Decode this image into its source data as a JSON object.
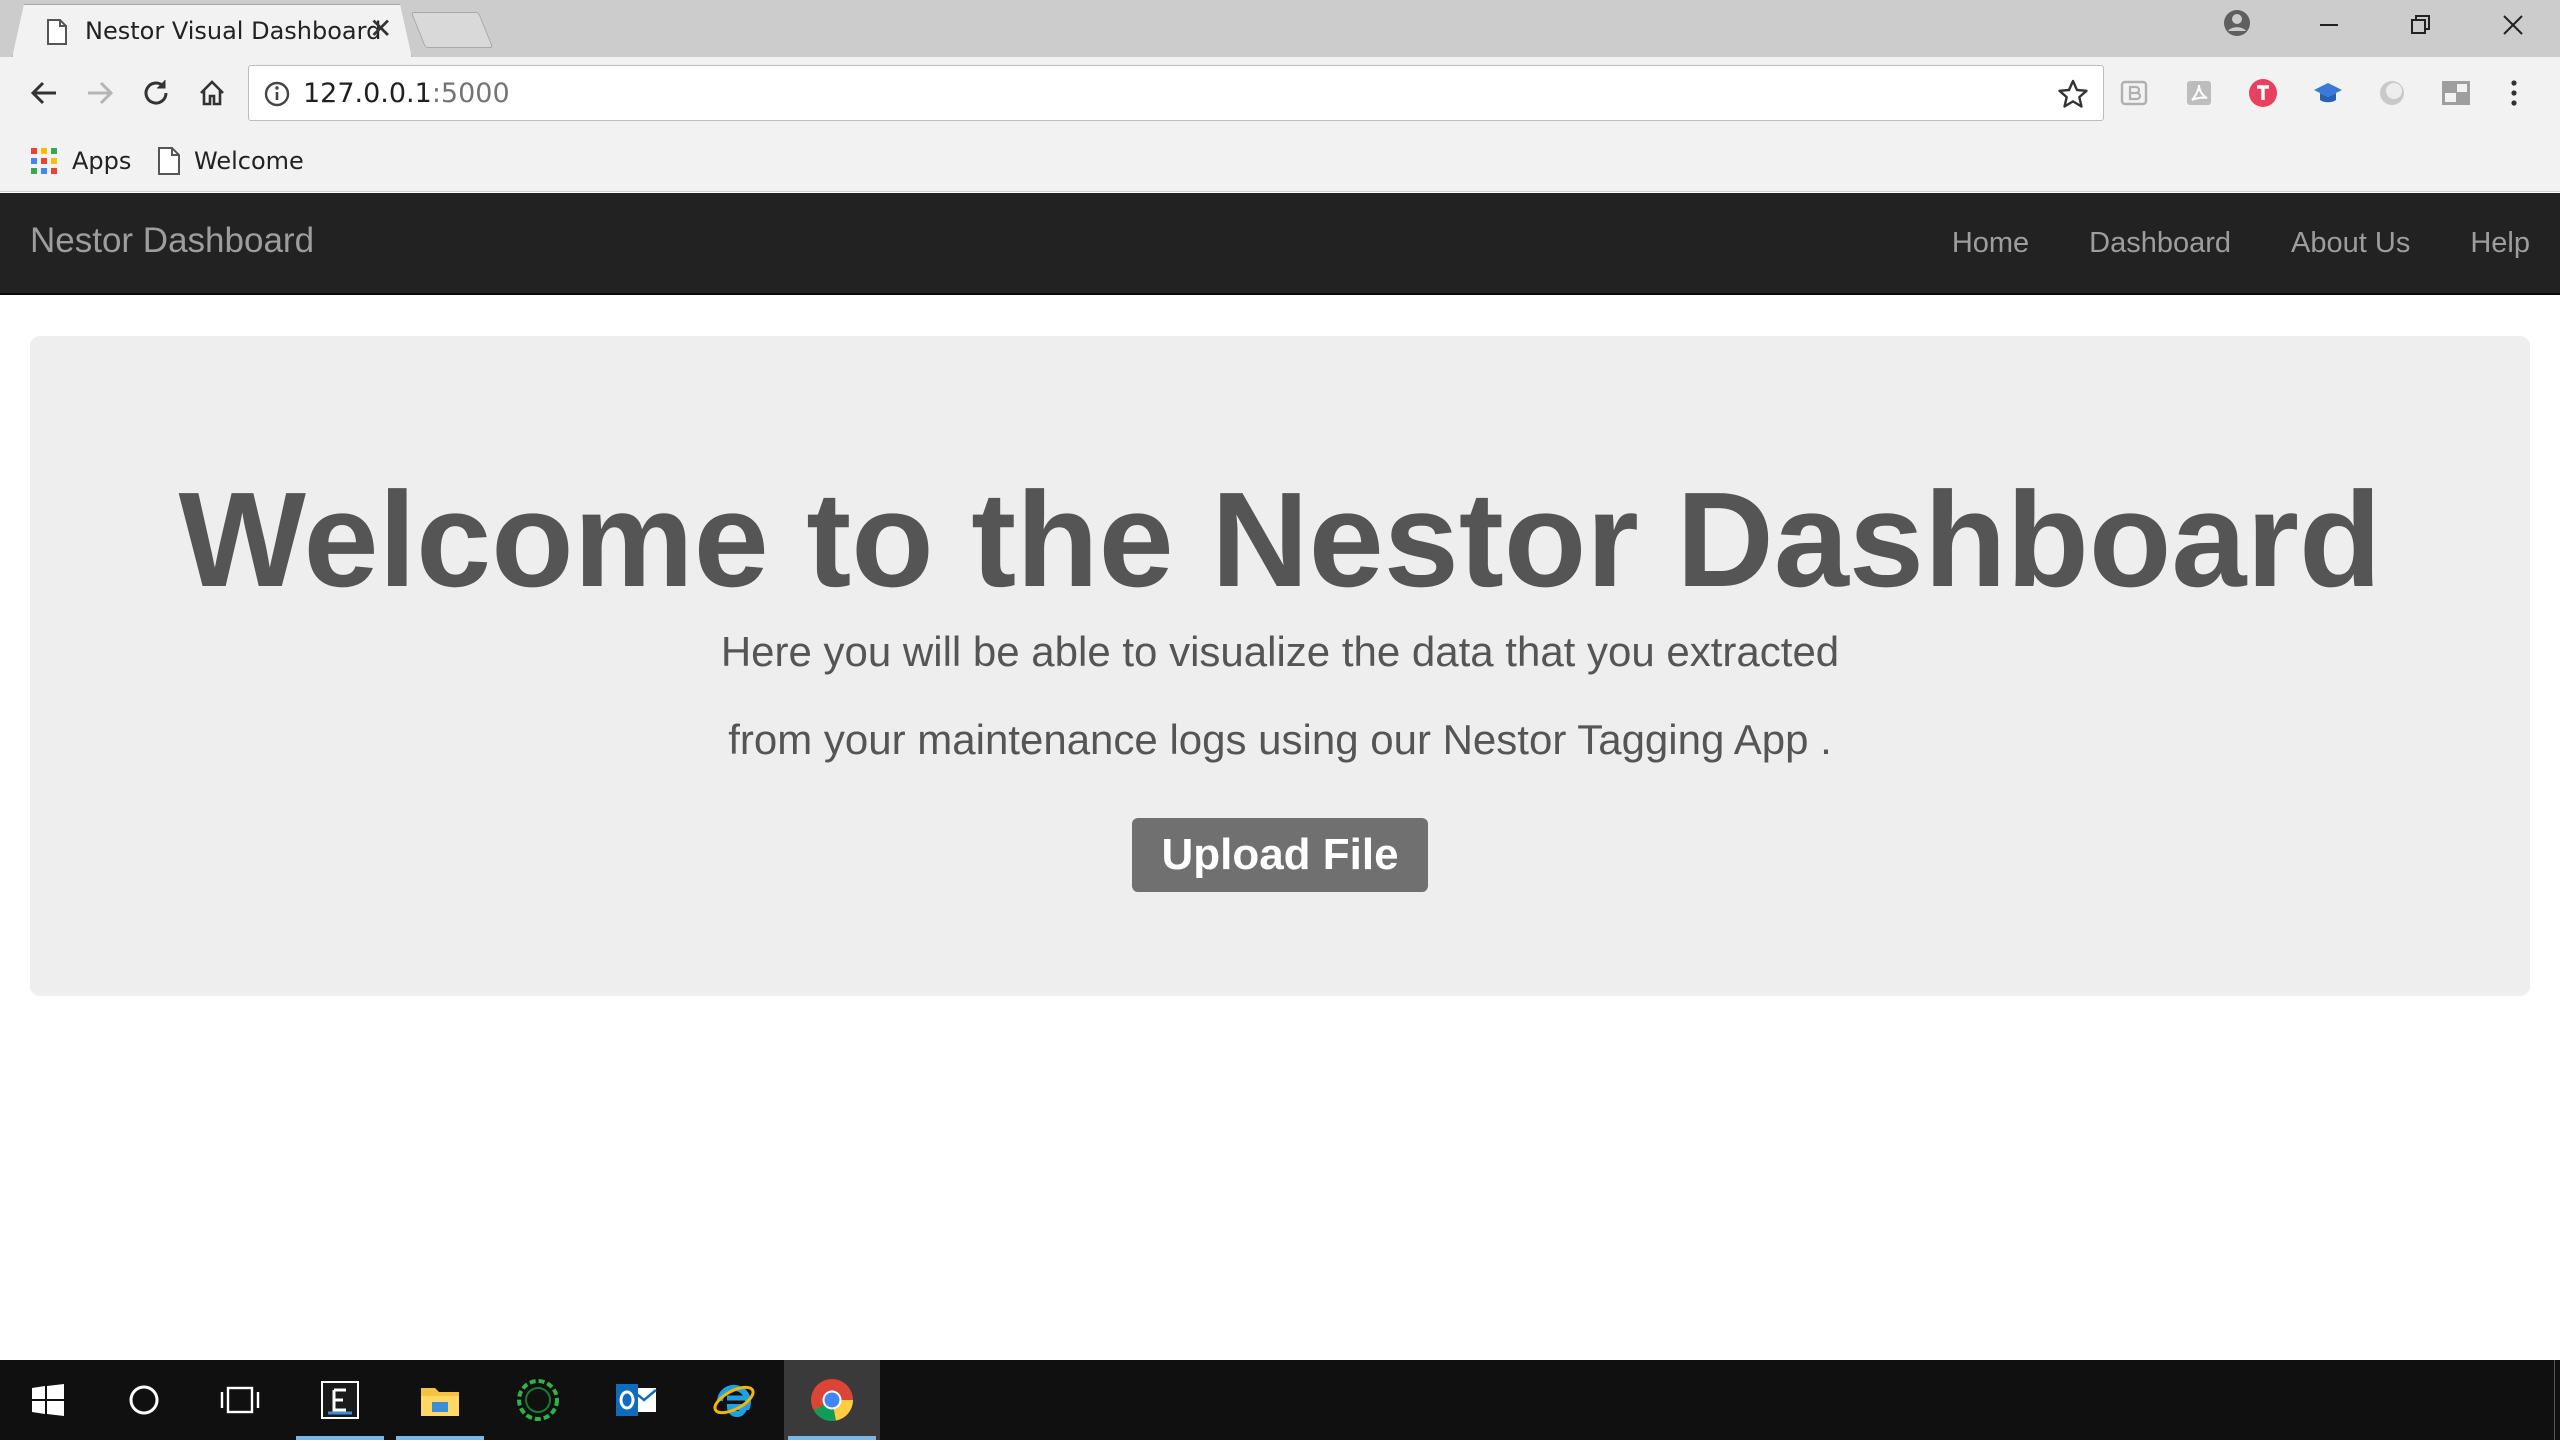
{
  "browser": {
    "tab": {
      "title": "Nestor Visual Dashboard",
      "close_glyph": "✕"
    },
    "window_controls": {
      "minimize": "—",
      "restore": "❐",
      "close": "✕"
    },
    "address": {
      "host": "127.0.0.1",
      "port": ":5000"
    },
    "bookmarks": [
      {
        "label": "Apps",
        "icon": "apps-grid-icon"
      },
      {
        "label": "Welcome",
        "icon": "page-icon"
      }
    ],
    "extensions": [
      "b-extension-icon",
      "pdf-extension-icon",
      "t-extension-icon",
      "cap-extension-icon",
      "circle-extension-icon",
      "window-extension-icon"
    ]
  },
  "navbar": {
    "brand": "Nestor Dashboard",
    "links": [
      "Home",
      "Dashboard",
      "About Us",
      "Help"
    ]
  },
  "jumbotron": {
    "title": "Welcome to the Nestor Dashboard",
    "line1": "Here you will be able to visualize the data that you extracted",
    "line2": "from your maintenance logs using our Nestor Tagging App .",
    "button": "Upload File"
  },
  "taskbar": {
    "items": [
      "windows-start-icon",
      "cortana-search-icon",
      "task-view-icon",
      "editor-app-icon",
      "file-explorer-icon",
      "loader-app-icon",
      "outlook-icon",
      "internet-explorer-icon",
      "chrome-icon"
    ]
  },
  "colors": {
    "navbar_bg": "#222222",
    "jumbotron_bg": "#eeeeee",
    "text": "#555555",
    "button_bg": "#707070"
  }
}
